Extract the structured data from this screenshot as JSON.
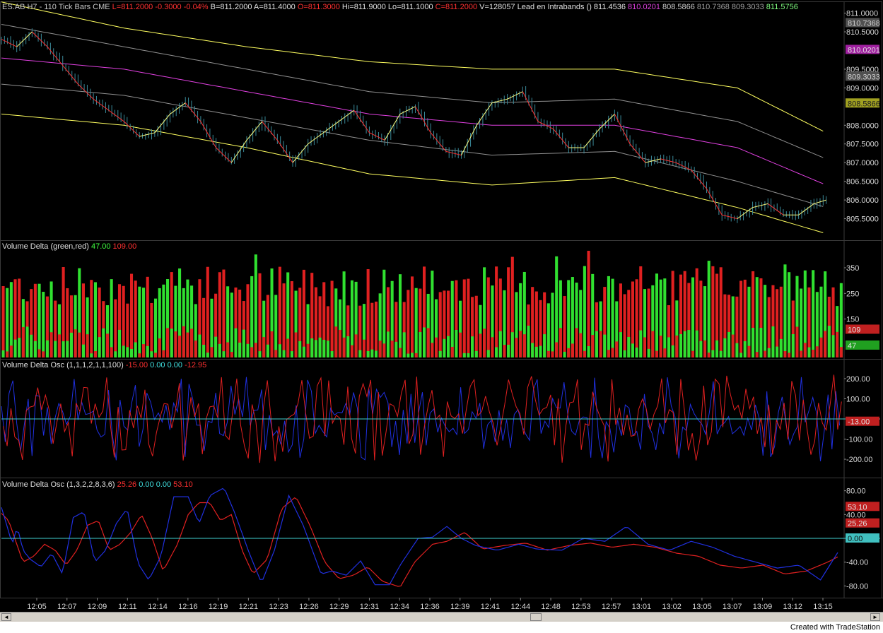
{
  "header": {
    "p1": [
      {
        "text": "ES.AB H7 - 110 Tick Bars  CME",
        "color": "#c8c8c8"
      },
      {
        "text": "L=811.2000",
        "color": "#ff3030"
      },
      {
        "text": "-0.3000",
        "color": "#ff3030"
      },
      {
        "text": "-0.04%",
        "color": "#ff3030"
      },
      {
        "text": "B=811.2000",
        "color": "#e0e0e0"
      },
      {
        "text": "A=811.4000",
        "color": "#e0e0e0"
      },
      {
        "text": "O=811.3000",
        "color": "#ff3030"
      },
      {
        "text": "Hi=811.9000",
        "color": "#e0e0e0"
      },
      {
        "text": "Lo=811.1000",
        "color": "#e0e0e0"
      },
      {
        "text": "C=811.2000",
        "color": "#ff3030"
      },
      {
        "text": "V=128057",
        "color": "#e0e0e0"
      },
      {
        "text": "Lead en Intrabands  ()",
        "color": "#e0e0e0"
      },
      {
        "text": "811.4536",
        "color": "#e8e8e8"
      },
      {
        "text": "810.0201",
        "color": "#e040e0"
      },
      {
        "text": "808.5866",
        "color": "#d0d0d0"
      },
      {
        "text": "810.7368",
        "color": "#a0a0a0"
      },
      {
        "text": "809.3033",
        "color": "#a0a0a0"
      },
      {
        "text": "811.5756",
        "color": "#80ff80"
      }
    ],
    "p2": [
      {
        "text": "Volume Delta  (green,red)",
        "color": "#e0e0e0"
      },
      {
        "text": "47.00",
        "color": "#40ff40"
      },
      {
        "text": "109.00",
        "color": "#ff3030"
      }
    ],
    "p3": [
      {
        "text": "Volume Delta Osc  (1,1,1,2,1,1,100)",
        "color": "#e0e0e0"
      },
      {
        "text": "-15.00",
        "color": "#ff3030"
      },
      {
        "text": "0.00",
        "color": "#40e0e0"
      },
      {
        "text": "0.00",
        "color": "#40e0e0"
      },
      {
        "text": "-12.95",
        "color": "#ff3030"
      }
    ],
    "p4": [
      {
        "text": "Volume Delta Osc  (1,3,2,2,8,3,6)",
        "color": "#e0e0e0"
      },
      {
        "text": "25.26",
        "color": "#ff3030"
      },
      {
        "text": "0.00",
        "color": "#40e0e0"
      },
      {
        "text": "0.00",
        "color": "#40e0e0"
      },
      {
        "text": "53.10",
        "color": "#ff3030"
      }
    ]
  },
  "chart_data": [
    {
      "type": "bar",
      "subtype": "ohlc-tick-bars",
      "x_ticks": [
        "12:05",
        "12:07",
        "12:09",
        "12:11",
        "12:14",
        "12:16",
        "12:19",
        "12:21",
        "12:23",
        "12:26",
        "12:29",
        "12:31",
        "12:34",
        "12:36",
        "12:39",
        "12:41",
        "12:44",
        "12:48",
        "12:53",
        "12:57",
        "13:01",
        "13:02",
        "13:05",
        "13:07",
        "13:09",
        "13:12",
        "13:15"
      ],
      "ylim": [
        805.0,
        811.2
      ],
      "y_ticks": [
        "811.0000",
        "810.5000",
        "809.5000",
        "809.0000",
        "808.0000",
        "807.5000",
        "807.0000",
        "806.5000",
        "806.0000",
        "805.5000"
      ],
      "price_anchors": [
        [
          0,
          810.3
        ],
        [
          5,
          810.1
        ],
        [
          10,
          810.5
        ],
        [
          15,
          810.1
        ],
        [
          20,
          809.6
        ],
        [
          25,
          809.1
        ],
        [
          30,
          808.7
        ],
        [
          35,
          808.4
        ],
        [
          40,
          808.1
        ],
        [
          45,
          807.7
        ],
        [
          50,
          807.8
        ],
        [
          55,
          808.3
        ],
        [
          60,
          808.6
        ],
        [
          65,
          808.1
        ],
        [
          70,
          807.4
        ],
        [
          75,
          807.0
        ],
        [
          80,
          807.6
        ],
        [
          85,
          808.1
        ],
        [
          90,
          807.6
        ],
        [
          95,
          807.0
        ],
        [
          100,
          807.5
        ],
        [
          105,
          807.8
        ],
        [
          110,
          808.1
        ],
        [
          115,
          808.4
        ],
        [
          120,
          807.8
        ],
        [
          125,
          807.6
        ],
        [
          130,
          808.3
        ],
        [
          135,
          808.5
        ],
        [
          140,
          807.8
        ],
        [
          145,
          807.3
        ],
        [
          150,
          807.2
        ],
        [
          155,
          808.0
        ],
        [
          160,
          808.6
        ],
        [
          165,
          808.7
        ],
        [
          170,
          808.9
        ],
        [
          175,
          808.1
        ],
        [
          180,
          807.9
        ],
        [
          185,
          807.4
        ],
        [
          190,
          807.4
        ],
        [
          195,
          807.9
        ],
        [
          200,
          808.3
        ],
        [
          205,
          807.5
        ],
        [
          210,
          807.0
        ],
        [
          215,
          807.1
        ],
        [
          220,
          807.0
        ],
        [
          225,
          806.8
        ],
        [
          230,
          806.3
        ],
        [
          235,
          805.6
        ],
        [
          240,
          805.5
        ],
        [
          245,
          805.8
        ],
        [
          250,
          805.9
        ],
        [
          255,
          805.6
        ],
        [
          260,
          805.6
        ],
        [
          265,
          805.9
        ],
        [
          269,
          806.0
        ]
      ],
      "series": [
        {
          "name": "811.4536",
          "color": "#ffff60",
          "anchors": [
            [
              0,
              811.3
            ],
            [
              40,
              810.6
            ],
            [
              80,
              810.1
            ],
            [
              120,
              809.7
            ],
            [
              160,
              809.5
            ],
            [
              200,
              809.5
            ],
            [
              240,
              809.0
            ],
            [
              269,
              807.8
            ]
          ]
        },
        {
          "name": "810.7368",
          "color": "#909090",
          "anchors": [
            [
              0,
              810.7
            ],
            [
              40,
              810.1
            ],
            [
              80,
              809.5
            ],
            [
              120,
              808.9
            ],
            [
              160,
              808.6
            ],
            [
              200,
              808.7
            ],
            [
              240,
              808.1
            ],
            [
              269,
              807.1
            ]
          ]
        },
        {
          "name": "810.0201",
          "color": "#e040e0",
          "anchors": [
            [
              0,
              809.8
            ],
            [
              40,
              809.5
            ],
            [
              80,
              808.9
            ],
            [
              120,
              808.3
            ],
            [
              160,
              808.0
            ],
            [
              200,
              808.0
            ],
            [
              240,
              807.4
            ],
            [
              269,
              806.4
            ]
          ]
        },
        {
          "name": "809.3033",
          "color": "#909090",
          "anchors": [
            [
              0,
              809.1
            ],
            [
              40,
              808.8
            ],
            [
              80,
              808.2
            ],
            [
              120,
              807.6
            ],
            [
              160,
              807.2
            ],
            [
              200,
              807.3
            ],
            [
              240,
              806.5
            ],
            [
              269,
              805.8
            ]
          ]
        },
        {
          "name": "808.5866",
          "color": "#ffff60",
          "anchors": [
            [
              0,
              808.3
            ],
            [
              40,
              808.0
            ],
            [
              80,
              807.4
            ],
            [
              120,
              806.7
            ],
            [
              160,
              806.4
            ],
            [
              200,
              806.6
            ],
            [
              240,
              805.8
            ],
            [
              269,
              805.1
            ]
          ]
        }
      ],
      "right_tags": [
        {
          "text": "810.7368",
          "value": 810.7368,
          "bg": "#505050",
          "fg": "#d0d0d0"
        },
        {
          "text": "810.0201",
          "value": 810.0201,
          "bg": "#a020a0",
          "fg": "#e0e0e0"
        },
        {
          "text": "809.3033",
          "value": 809.3033,
          "bg": "#505050",
          "fg": "#d0d0d0"
        },
        {
          "text": "808.5866",
          "value": 808.5866,
          "bg": "#a0a020",
          "fg": "#202020"
        }
      ]
    },
    {
      "type": "bar",
      "subtype": "volume-delta",
      "ylim": [
        0,
        430
      ],
      "y_ticks": [
        "350",
        "250",
        "150"
      ],
      "seed": 7,
      "right_tags": [
        {
          "text": "109",
          "value": 109,
          "bg": "#c02020",
          "fg": "#e0e0e0"
        },
        {
          "text": "47",
          "value": 47,
          "bg": "#20a020",
          "fg": "#e0e0e0"
        }
      ]
    },
    {
      "type": "line",
      "subtype": "volume-delta-osc-fast",
      "ylim": [
        -270,
        270
      ],
      "y_ticks": [
        "200.00",
        "100.00",
        "-100.00",
        "-200.00"
      ],
      "zero_tag": {
        "text": "-13.00",
        "value": -13,
        "bg": "#c02020",
        "fg": "#e0e0e0"
      },
      "seed": 11
    },
    {
      "type": "line",
      "subtype": "volume-delta-osc-slow",
      "ylim": [
        -95,
        95
      ],
      "y_ticks": [
        "80.00",
        "40.00",
        "-40.00",
        "-80.00"
      ],
      "zero_tag": {
        "text": "0.00",
        "value": 0,
        "bg": "#40c0c0",
        "fg": "#101010"
      },
      "right_tags": [
        {
          "text": "53.10",
          "value": 53.1,
          "bg": "#c02020",
          "fg": "#e0e0e0"
        },
        {
          "text": "25.26",
          "value": 25.26,
          "bg": "#c02020",
          "fg": "#e0e0e0"
        }
      ],
      "blue_anchors": [
        [
          0,
          52
        ],
        [
          8,
          20
        ],
        [
          15,
          -10
        ],
        [
          22,
          20
        ],
        [
          30,
          -20
        ],
        [
          40,
          -35
        ],
        [
          55,
          -48
        ],
        [
          70,
          -25
        ],
        [
          85,
          -60
        ],
        [
          100,
          35
        ],
        [
          115,
          45
        ],
        [
          130,
          -40
        ],
        [
          145,
          -20
        ],
        [
          160,
          25
        ],
        [
          175,
          50
        ],
        [
          190,
          -42
        ],
        [
          205,
          -70
        ],
        [
          222,
          -30
        ],
        [
          240,
          70
        ],
        [
          260,
          70
        ],
        [
          275,
          25
        ],
        [
          290,
          72
        ],
        [
          310,
          85
        ],
        [
          325,
          42
        ],
        [
          345,
          -25
        ],
        [
          362,
          -75
        ],
        [
          380,
          -20
        ],
        [
          400,
          72
        ],
        [
          420,
          22
        ],
        [
          445,
          -60
        ],
        [
          460,
          -55
        ],
        [
          480,
          -62
        ],
        [
          500,
          -38
        ],
        [
          520,
          -78
        ],
        [
          540,
          -78
        ],
        [
          555,
          -45
        ],
        [
          580,
          0
        ],
        [
          600,
          2
        ],
        [
          620,
          20
        ],
        [
          640,
          0
        ],
        [
          660,
          -12
        ],
        [
          690,
          -20
        ],
        [
          720,
          -10
        ],
        [
          745,
          -18
        ],
        [
          780,
          -20
        ],
        [
          810,
          0
        ],
        [
          840,
          -5
        ],
        [
          870,
          20
        ],
        [
          900,
          -10
        ],
        [
          930,
          -20
        ],
        [
          960,
          -5
        ],
        [
          990,
          -15
        ],
        [
          1020,
          -30
        ],
        [
          1050,
          -40
        ],
        [
          1080,
          -50
        ],
        [
          1110,
          -45
        ],
        [
          1140,
          -70
        ],
        [
          1166,
          -20
        ]
      ],
      "red_anchors": [
        [
          0,
          42
        ],
        [
          10,
          30
        ],
        [
          20,
          -5
        ],
        [
          30,
          -40
        ],
        [
          45,
          -30
        ],
        [
          60,
          -10
        ],
        [
          75,
          -20
        ],
        [
          90,
          -45
        ],
        [
          105,
          -20
        ],
        [
          120,
          22
        ],
        [
          135,
          30
        ],
        [
          150,
          -20
        ],
        [
          165,
          -10
        ],
        [
          180,
          10
        ],
        [
          195,
          40
        ],
        [
          210,
          0
        ],
        [
          225,
          -55
        ],
        [
          245,
          -10
        ],
        [
          260,
          40
        ],
        [
          275,
          60
        ],
        [
          290,
          60
        ],
        [
          305,
          30
        ],
        [
          320,
          40
        ],
        [
          335,
          -20
        ],
        [
          350,
          -60
        ],
        [
          370,
          -35
        ],
        [
          390,
          50
        ],
        [
          410,
          70
        ],
        [
          430,
          20
        ],
        [
          450,
          -40
        ],
        [
          470,
          -68
        ],
        [
          490,
          -62
        ],
        [
          510,
          -48
        ],
        [
          530,
          -72
        ],
        [
          555,
          -82
        ],
        [
          575,
          -40
        ],
        [
          600,
          -10
        ],
        [
          620,
          -5
        ],
        [
          645,
          10
        ],
        [
          670,
          -18
        ],
        [
          700,
          -12
        ],
        [
          730,
          -8
        ],
        [
          760,
          -20
        ],
        [
          790,
          -12
        ],
        [
          820,
          -8
        ],
        [
          850,
          -15
        ],
        [
          880,
          -10
        ],
        [
          910,
          -15
        ],
        [
          940,
          -25
        ],
        [
          970,
          -30
        ],
        [
          1000,
          -45
        ],
        [
          1030,
          -50
        ],
        [
          1060,
          -45
        ],
        [
          1090,
          -60
        ],
        [
          1120,
          -55
        ],
        [
          1150,
          -40
        ],
        [
          1166,
          -30
        ]
      ]
    }
  ],
  "scrollbar": {
    "left": "◄",
    "right": "►"
  },
  "footer": {
    "credit": "Created with TradeStation"
  }
}
